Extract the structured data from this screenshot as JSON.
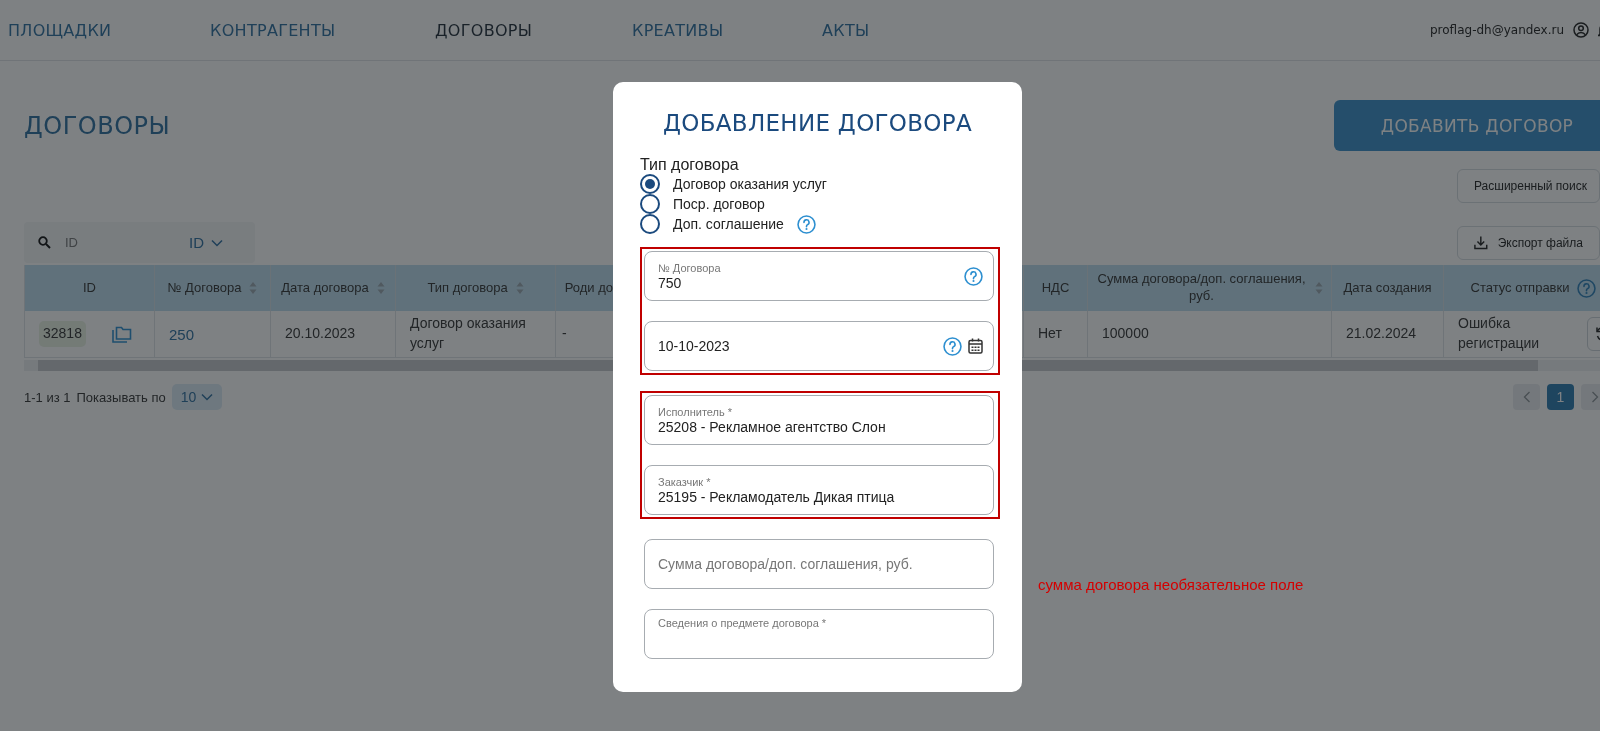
{
  "nav": {
    "items": [
      {
        "label": "ПЛОЩАДКИ",
        "selected": false
      },
      {
        "label": "КОНТРАГЕНТЫ",
        "selected": false
      },
      {
        "label": "ДОГОВОРЫ",
        "selected": true
      },
      {
        "label": "КРЕАТИВЫ",
        "selected": false
      },
      {
        "label": "АКТЫ",
        "selected": false
      }
    ],
    "user_email": "proflag-dh@yandex.ru"
  },
  "page": {
    "title": "ДОГОВОРЫ",
    "add_button": "ДОБАВИТЬ ДОГОВОР",
    "advanced_search_button": "Расширенный поиск",
    "export_button": "Экспорт файла"
  },
  "search": {
    "placeholder": "ID",
    "field": "ID"
  },
  "table": {
    "columns": [
      {
        "label": "ID",
        "kind": "id",
        "sortable": false,
        "help": false
      },
      {
        "label": "№ Договора",
        "kind": "link",
        "sortable": true,
        "help": false
      },
      {
        "label": "Дата договора",
        "kind": "text",
        "sortable": true,
        "help": false
      },
      {
        "label": "Тип договора",
        "kind": "text",
        "sortable": true,
        "help": false
      },
      {
        "label": "Роди до",
        "kind": "cut",
        "sortable": false,
        "help": false
      },
      {
        "label": "НДС",
        "kind": "text",
        "sortable": false,
        "help": false
      },
      {
        "label": "Сумма договора/доп. соглашения, руб.",
        "kind": "text",
        "sortable": true,
        "help": false
      },
      {
        "label": "Дата создания",
        "kind": "text",
        "sortable": false,
        "help": false
      },
      {
        "label": "Статус отправки",
        "kind": "status",
        "sortable": false,
        "help": true
      }
    ],
    "rows": [
      {
        "cells": [
          "32818",
          "250",
          "20.10.2023",
          "Договор оказания услуг",
          "-",
          "Нет",
          "100000",
          "21.02.2024",
          "Ошибка регистрации"
        ]
      }
    ]
  },
  "pagination": {
    "summary": "1-1 из 1",
    "per_page_label": "Показывать по",
    "per_page": "10",
    "pages": [
      {
        "label": "1",
        "selected": true
      }
    ]
  },
  "modal": {
    "title": "ДОБАВЛЕНИЕ ДОГОВОРА",
    "contract_type": {
      "label": "Тип договора",
      "options": [
        {
          "label": "Договор оказания услуг",
          "selected": true,
          "help": false
        },
        {
          "label": "Поср. договор",
          "selected": false,
          "help": false
        },
        {
          "label": "Доп. соглашение",
          "selected": false,
          "help": true
        }
      ]
    },
    "groups": [
      {
        "highlighted": true,
        "fields": [
          {
            "label": "№ Договора",
            "value": "750",
            "help": true,
            "calendar": false
          },
          {
            "value": "10-10-2023",
            "help": true,
            "calendar": true
          }
        ]
      },
      {
        "highlighted": true,
        "fields": [
          {
            "label": "Исполнитель *",
            "value": "25208 - Рекламное агентство Слон",
            "help": false,
            "calendar": false
          },
          {
            "label": "Заказчик *",
            "value": "25195 - Рекламодатель Дикая птица",
            "help": false,
            "calendar": false
          }
        ]
      },
      {
        "highlighted": false,
        "fields": [
          {
            "placeholder": "Сумма договора/доп. соглашения, руб.",
            "help": false,
            "calendar": false
          },
          {
            "label": "Сведения о предмете договора *",
            "help": false,
            "calendar": false
          }
        ]
      }
    ]
  },
  "annotation": {
    "text": "сумма договора необязательное поле"
  }
}
